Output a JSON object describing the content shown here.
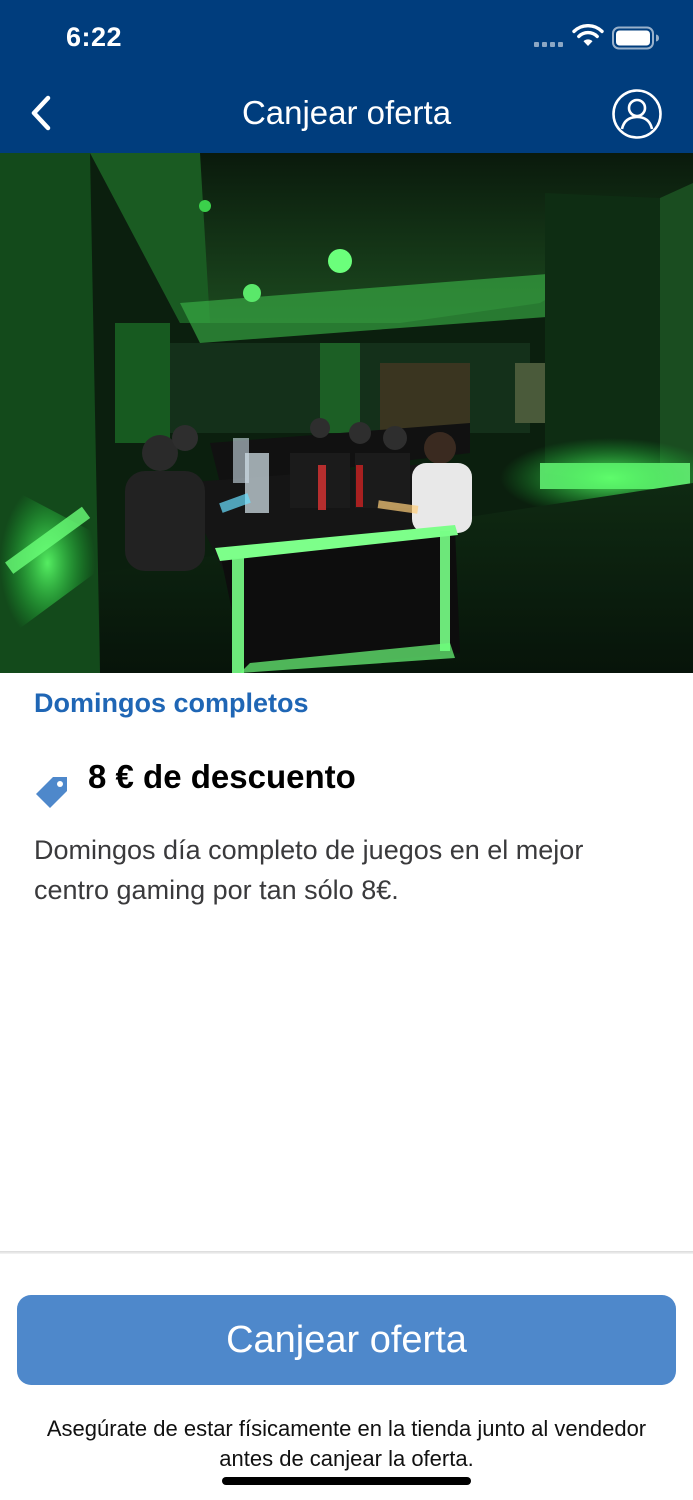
{
  "status_bar": {
    "time": "6:22"
  },
  "nav": {
    "title": "Canjear oferta"
  },
  "offer": {
    "name": "Domingos completos",
    "discount": "8 € de descuento",
    "description": "Domingos día completo de juegos en el mejor centro gaming por tan sólo 8€."
  },
  "footer": {
    "redeem_label": "Canjear oferta",
    "note": "Asegúrate de estar físicamente en la tienda junto al vendedor antes de canjear la oferta."
  },
  "colors": {
    "header": "#003d7d",
    "accent": "#1f66b5",
    "button": "#4e88cb"
  },
  "icons": {
    "back": "chevron-left-icon",
    "profile": "user-circle-icon",
    "tag": "price-tag-icon"
  }
}
